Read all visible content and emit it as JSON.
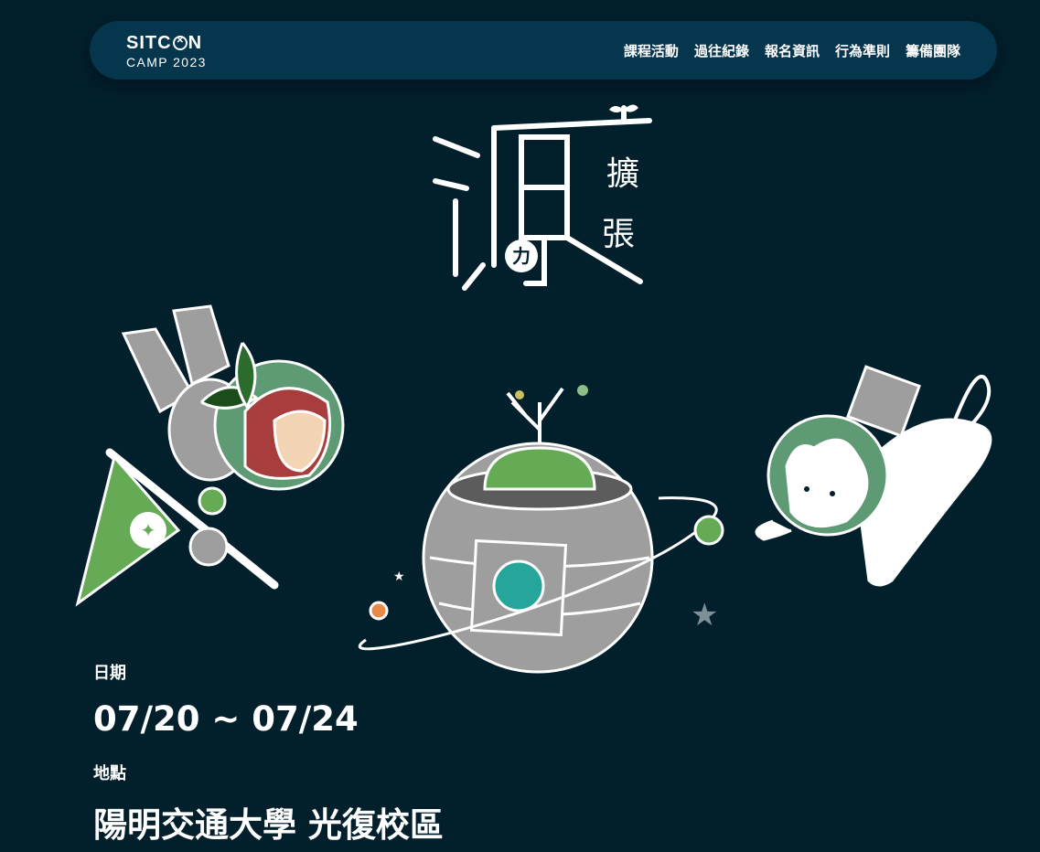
{
  "logo": {
    "top_text": "SITCON",
    "bottom_text": "CAMP 2023"
  },
  "menu": [
    "課程活動",
    "過往紀錄",
    "報名資訊",
    "行為準則",
    "籌備團隊"
  ],
  "hero": {
    "title": "源",
    "sub_chars": [
      "擴",
      "張"
    ],
    "circle_char": "力"
  },
  "date": {
    "label": "日期",
    "value": "07/20 ~ 07/24"
  },
  "location": {
    "label": "地點",
    "value": "陽明交通大學 光復校區"
  },
  "colors": {
    "background": "#021f2c",
    "nav": "#06364d",
    "green": "#65ab55",
    "teal": "#26a69a",
    "orange": "#e68a45"
  }
}
